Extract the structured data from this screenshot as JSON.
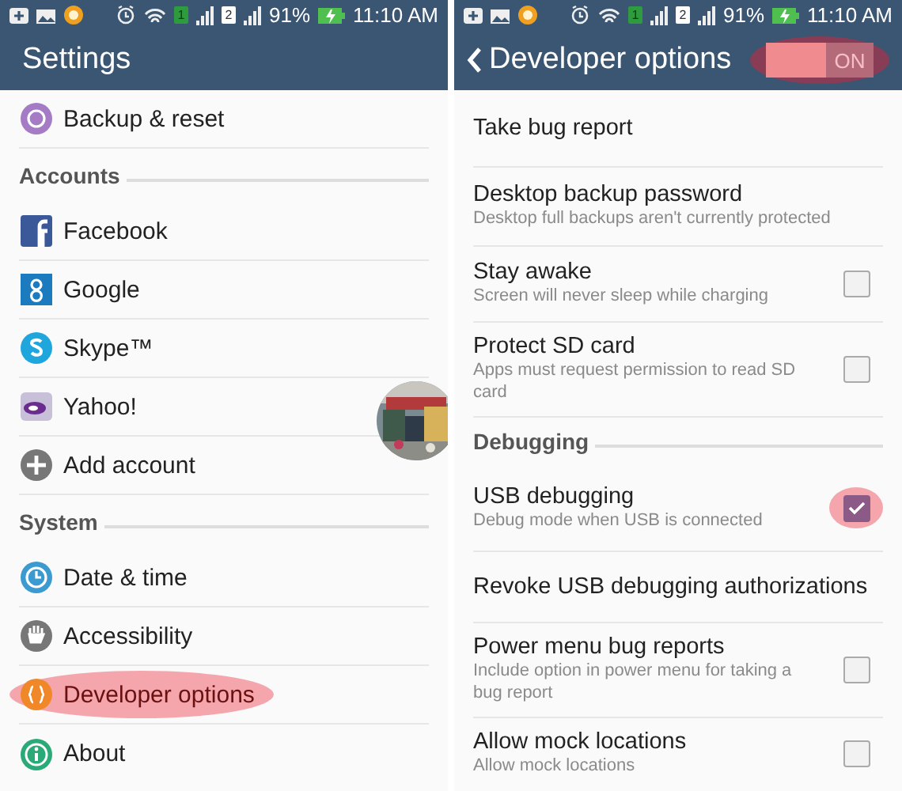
{
  "left": {
    "status_bar": {
      "sims": [
        "1",
        "2"
      ],
      "battery": "91%",
      "time": "11:10 AM"
    },
    "title": "Settings",
    "items": [
      {
        "kind": "item",
        "label": "Backup & reset",
        "highlighted": false
      },
      {
        "kind": "header",
        "label": "Accounts"
      },
      {
        "kind": "item",
        "label": "Facebook",
        "highlighted": false
      },
      {
        "kind": "item",
        "label": "Google",
        "highlighted": false
      },
      {
        "kind": "item",
        "label": "Skype™",
        "highlighted": false
      },
      {
        "kind": "item",
        "label": "Yahoo!",
        "highlighted": false
      },
      {
        "kind": "item",
        "label": "Add account",
        "highlighted": false
      },
      {
        "kind": "header",
        "label": "System"
      },
      {
        "kind": "item",
        "label": "Date & time",
        "highlighted": false
      },
      {
        "kind": "item",
        "label": "Accessibility",
        "highlighted": false
      },
      {
        "kind": "item",
        "label": "Developer options",
        "highlighted": true
      },
      {
        "kind": "item",
        "label": "About",
        "highlighted": false
      }
    ]
  },
  "right": {
    "status_bar": {
      "sims": [
        "1",
        "2"
      ],
      "battery": "91%",
      "time": "11:10 AM"
    },
    "title": "Developer options",
    "toggle": {
      "label": "ON",
      "on": true,
      "highlighted": true
    },
    "items": [
      {
        "kind": "action",
        "title": "Take bug report"
      },
      {
        "kind": "action",
        "title": "Desktop backup password",
        "summary": "Desktop full backups aren't currently protected"
      },
      {
        "kind": "check",
        "title": "Stay awake",
        "summary": "Screen will never sleep while charging",
        "checked": false,
        "highlighted": false
      },
      {
        "kind": "check",
        "title": "Protect SD card",
        "summary": "Apps must request permission to read SD card",
        "checked": false,
        "highlighted": false
      },
      {
        "kind": "header",
        "title": "Debugging"
      },
      {
        "kind": "check",
        "title": "USB debugging",
        "summary": "Debug mode when USB is connected",
        "checked": true,
        "highlighted": true
      },
      {
        "kind": "action",
        "title": "Revoke USB debugging authorizations"
      },
      {
        "kind": "check",
        "title": "Power menu bug reports",
        "summary": "Include option in power menu for taking a bug report",
        "checked": false,
        "highlighted": false
      },
      {
        "kind": "check",
        "title": "Allow mock locations",
        "summary": "Allow mock locations",
        "checked": false,
        "highlighted": false
      }
    ]
  }
}
